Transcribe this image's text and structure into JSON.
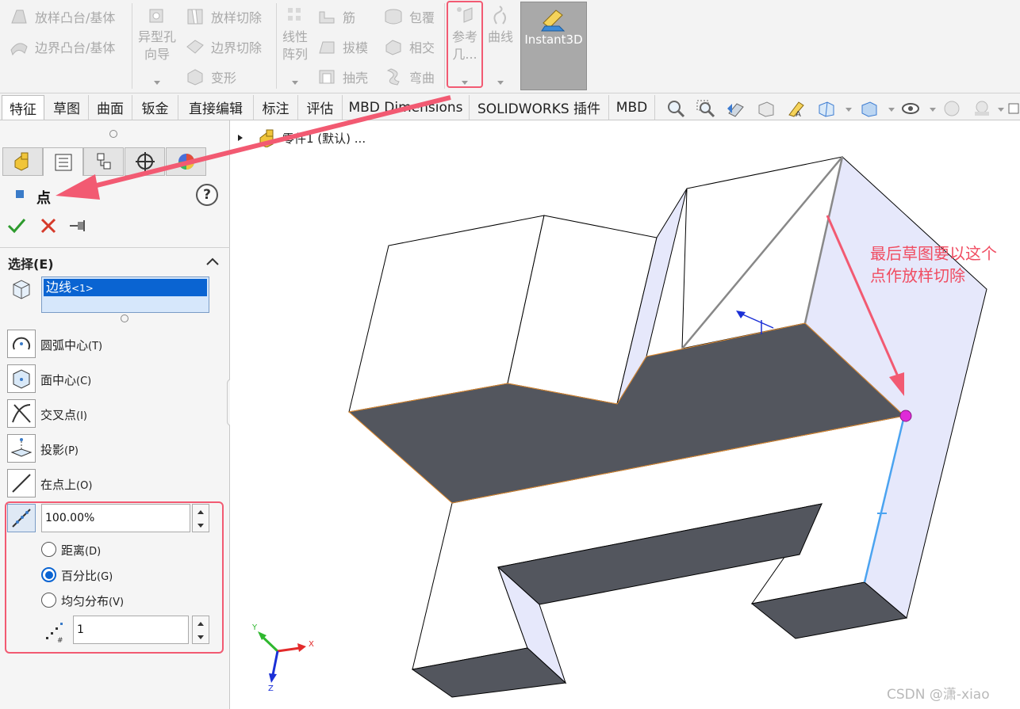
{
  "ribbon": {
    "col1": [
      "放样凸台/基体",
      "边界凸台/基体"
    ],
    "hole_wizard": [
      "异型孔",
      "向导"
    ],
    "col3": [
      "放样切除",
      "边界切除",
      "变形"
    ],
    "linear_pattern": [
      "线性",
      "阵列"
    ],
    "col5": [
      "筋",
      "拔模",
      "抽壳"
    ],
    "col6": [
      "包覆",
      "相交",
      "弯曲"
    ],
    "ref_geom": [
      "参考",
      "几..."
    ],
    "curves": "曲线",
    "instant3d": "Instant3D"
  },
  "tabs": [
    "特征",
    "草图",
    "曲面",
    "钣金",
    "直接编辑",
    "标注",
    "评估",
    "MBD Dimensions",
    "SOLIDWORKS 插件",
    "MBD"
  ],
  "tree": {
    "root_label": "零件1 (默认) ..."
  },
  "panel": {
    "title": "点",
    "help": "?",
    "section_select": "选择(E)",
    "selected_item": "边线",
    "selected_item_sub": "<1>",
    "options": [
      {
        "label": "圆弧中心",
        "key": "(T)",
        "icon": "arc-center-icon"
      },
      {
        "label": "面中心",
        "key": "(C)",
        "icon": "face-center-icon"
      },
      {
        "label": "交叉点",
        "key": "(I)",
        "icon": "intersection-icon"
      },
      {
        "label": "投影",
        "key": "(P)",
        "icon": "projection-icon"
      },
      {
        "label": "在点上",
        "key": "(O)",
        "icon": "on-point-icon"
      }
    ],
    "percent_value": "100.00%",
    "radios": [
      {
        "label": "距离",
        "key": "(D)",
        "selected": false
      },
      {
        "label": "百分比",
        "key": "(G)",
        "selected": true
      },
      {
        "label": "均匀分布",
        "key": "(V)",
        "selected": false
      }
    ],
    "count_value": "1"
  },
  "triad": {
    "x": "X",
    "y": "Y",
    "z": "Z"
  },
  "annotation": [
    "最后草图要以这个",
    "点作放样切除"
  ],
  "watermark": "CSDN @潇-xiao",
  "colors": {
    "accent": "#0a64d2",
    "highlight": "#f25a72",
    "face_dark": "#53565e",
    "face_light": "#e6e8fb"
  }
}
